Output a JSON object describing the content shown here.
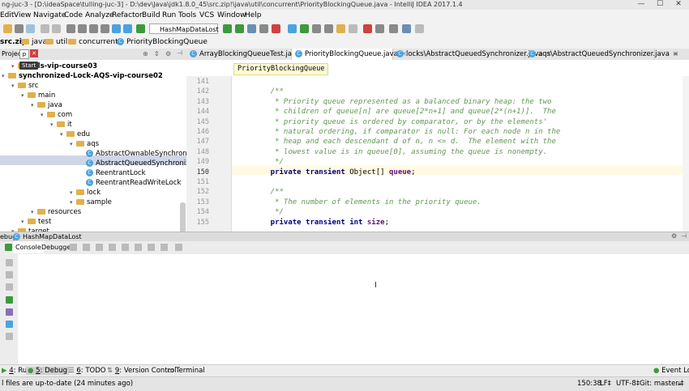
{
  "window": {
    "title": "ng-juc-3 - [D:\\ideaSpace\\tulling-juc-3] - D:\\dev\\Java\\jdk1.8.0_45\\src.zip!\\java\\util\\concurrent\\PriorityBlockingQueue.java - IntelliJ IDEA 2017.1.4",
    "minimize": "—",
    "maximize": "☐",
    "close": "✕"
  },
  "menu": [
    "Edit",
    "View",
    "Navigate",
    "Code",
    "Analyze",
    "Refactor",
    "Build",
    "Run",
    "Tools",
    "VCS",
    "Window",
    "Help"
  ],
  "toolbar": {
    "run_config": "HashMapDataLost",
    "colors": {
      "run": "#3c9a3c",
      "debug": "#3c9a3c",
      "stop": "#d04040",
      "neutral": "#8a8a8a",
      "accent": "#4aa3df"
    }
  },
  "navbar": {
    "crumbs": [
      "src.zip",
      "java",
      "util",
      "concurrent",
      "PriorityBlockingQueue"
    ]
  },
  "project": {
    "header_label": "Projec",
    "header_tab": "p",
    "tooltip": "Start",
    "tree": [
      {
        "label": "ools-vip-course03",
        "depth": 1,
        "bold": true
      },
      {
        "label": "synchronized-Lock-AQS-vip-course02",
        "depth": 0,
        "bold": true
      },
      {
        "label": "src",
        "depth": 1
      },
      {
        "label": "main",
        "depth": 2
      },
      {
        "label": "java",
        "depth": 3
      },
      {
        "label": "com",
        "depth": 4
      },
      {
        "label": "it",
        "depth": 5
      },
      {
        "label": "edu",
        "depth": 6
      },
      {
        "label": "aqs",
        "depth": 7
      },
      {
        "label": "AbstractOwnableSynchronizer",
        "depth": 8,
        "cls": true
      },
      {
        "label": "AbstractQueuedSynchronizer",
        "depth": 8,
        "cls": true
      },
      {
        "label": "ReentrantLock",
        "depth": 8,
        "cls": true
      },
      {
        "label": "ReentrantReadWriteLock",
        "depth": 8,
        "cls": true
      },
      {
        "label": "lock",
        "depth": 7
      },
      {
        "label": "sample",
        "depth": 7
      },
      {
        "label": "resources",
        "depth": 3
      },
      {
        "label": "test",
        "depth": 2
      },
      {
        "label": "target",
        "depth": 1
      }
    ]
  },
  "editor": {
    "tabs": [
      {
        "label": "ArrayBlockingQueueTest.java",
        "active": false
      },
      {
        "label": "PriorityBlockingQueue.java",
        "active": true
      },
      {
        "label": "locks\\AbstractQueuedSynchronizer.java",
        "active": false
      },
      {
        "label": "aqs\\AbstractQueuedSynchronizer.java",
        "active": false
      }
    ],
    "breadcrumb": "PriorityBlockingQueue",
    "current_line": "150",
    "lines": [
      {
        "n": "141",
        "parts": []
      },
      {
        "n": "142",
        "parts": [
          {
            "c": "cm",
            "t": "    /**"
          }
        ]
      },
      {
        "n": "143",
        "parts": [
          {
            "c": "cm",
            "t": "     * Priority queue represented as a balanced binary heap: the two"
          }
        ]
      },
      {
        "n": "144",
        "parts": [
          {
            "c": "cm",
            "t": "     * children of queue[n] are queue[2*n+1] and queue[2*(n+1)].  The"
          }
        ]
      },
      {
        "n": "145",
        "parts": [
          {
            "c": "cm",
            "t": "     * priority queue is ordered by comparator, or by the elements'"
          }
        ]
      },
      {
        "n": "146",
        "parts": [
          {
            "c": "cm",
            "t": "     * natural ordering, if comparator is null: For each node n in the"
          }
        ]
      },
      {
        "n": "147",
        "parts": [
          {
            "c": "cm",
            "t": "     * heap and each descendant d of n, n <= d.  The element with the"
          }
        ]
      },
      {
        "n": "148",
        "parts": [
          {
            "c": "cm",
            "t": "     * lowest value is in queue[0], assuming the queue is nonempty."
          }
        ]
      },
      {
        "n": "149",
        "parts": [
          {
            "c": "cm",
            "t": "     */"
          }
        ]
      },
      {
        "n": "150",
        "parts": [
          {
            "c": "kw",
            "t": "    private transient "
          },
          {
            "c": "",
            "t": "Object[] "
          },
          {
            "c": "fd",
            "t": "queue"
          },
          {
            "c": "",
            "t": ";"
          }
        ]
      },
      {
        "n": "151",
        "parts": []
      },
      {
        "n": "152",
        "parts": [
          {
            "c": "cm",
            "t": "    /**"
          }
        ]
      },
      {
        "n": "153",
        "parts": [
          {
            "c": "cm",
            "t": "     * The number of elements in the priority queue."
          }
        ]
      },
      {
        "n": "154",
        "parts": [
          {
            "c": "cm",
            "t": "     */"
          }
        ]
      },
      {
        "n": "155",
        "parts": [
          {
            "c": "kw",
            "t": "    private transient int "
          },
          {
            "c": "fd",
            "t": "size"
          },
          {
            "c": "",
            "t": ";"
          }
        ]
      }
    ]
  },
  "debug": {
    "header_label": "ebug",
    "header_config": "HashMapDataLost",
    "tabs": [
      "Console",
      "Debugger"
    ]
  },
  "toolwindows": [
    {
      "num": "4",
      "label": ": Run"
    },
    {
      "num": "5",
      "label": ": Debug"
    },
    {
      "num": "6",
      "label": ": TODO"
    },
    {
      "num": "9",
      "label": ": Version Control"
    },
    {
      "num": "",
      "label": "Terminal"
    }
  ],
  "status": {
    "message": "l files are up-to-date (24 minutes ago)",
    "position": "150:38",
    "line_sep": "LF‡",
    "encoding": "UTF-8‡",
    "git": "Git: master ‡",
    "event_log": "Event Log"
  }
}
